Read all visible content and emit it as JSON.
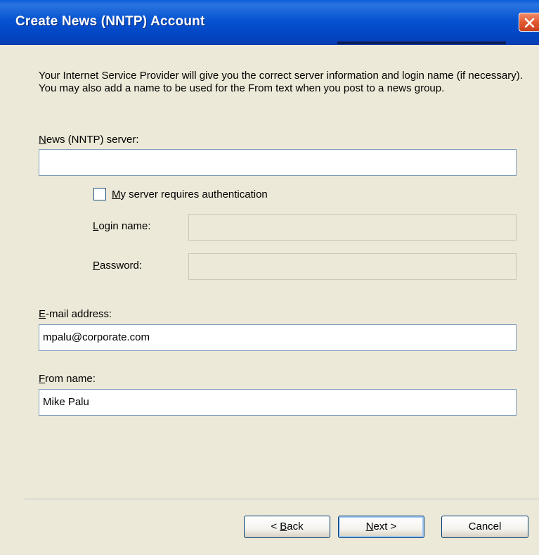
{
  "window": {
    "title": "Create News (NNTP) Account"
  },
  "intro_text": "Your Internet Service Provider will give you the correct server information and login name (if necessary).  You may also add a name to be used for the From text when you post to a news group.",
  "fields": {
    "server": {
      "label_mnemonic": "N",
      "label_rest": "ews (NNTP) server:",
      "value": ""
    },
    "auth_checkbox": {
      "label_mnemonic": "M",
      "label_rest": "y server requires authentication",
      "checked": false
    },
    "login": {
      "label_mnemonic": "L",
      "label_rest": "ogin name:",
      "value": "",
      "enabled": false
    },
    "password": {
      "label_mnemonic": "P",
      "label_rest": "assword:",
      "value": "",
      "enabled": false
    },
    "email": {
      "label_mnemonic": "E",
      "label_rest": "-mail address:",
      "value": "mpalu@corporate.com"
    },
    "from_name": {
      "label_mnemonic": "F",
      "label_rest": "rom name:",
      "value": "Mike Palu"
    }
  },
  "buttons": {
    "back": {
      "prefix": "< ",
      "mnemonic": "B",
      "rest": "ack"
    },
    "next": {
      "mnemonic": "N",
      "rest": "ext >"
    },
    "cancel": {
      "label": "Cancel"
    }
  },
  "icons": {
    "close": "close-icon"
  },
  "colors": {
    "titlebar": "#0553d0",
    "dialog_bg": "#ece9d8",
    "close_button": "#e25a32",
    "input_border": "#7f9db9"
  }
}
